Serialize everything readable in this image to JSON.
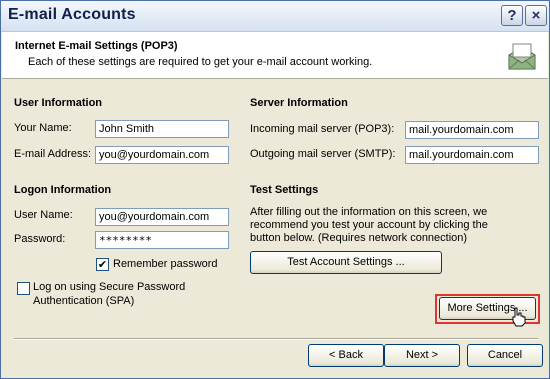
{
  "window": {
    "title": "E-mail Accounts",
    "help_glyph": "?",
    "close_glyph": "×"
  },
  "header": {
    "title": "Internet E-mail Settings (POP3)",
    "subtitle": "Each of these settings are required to get your e-mail account working.",
    "icon": "mail-envelope-icon"
  },
  "user_info": {
    "heading": "User Information",
    "name_label": "Your Name:",
    "name_value": "John Smith",
    "email_label": "E-mail Address:",
    "email_value": "you@yourdomain.com"
  },
  "logon_info": {
    "heading": "Logon Information",
    "user_label": "User Name:",
    "user_value": "you@yourdomain.com",
    "password_label": "Password:",
    "password_value": "********",
    "remember_label": "Remember password",
    "remember_checked": true,
    "spa_label_line1": "Log on using Secure Password",
    "spa_label_line2": "Authentication (SPA)",
    "spa_checked": false
  },
  "server_info": {
    "heading": "Server Information",
    "incoming_label": "Incoming mail server (POP3):",
    "incoming_value": "mail.yourdomain.com",
    "outgoing_label": "Outgoing mail server (SMTP):",
    "outgoing_value": "mail.yourdomain.com"
  },
  "test_settings": {
    "heading": "Test Settings",
    "description": "After filling out the information on this screen, we recommend you test your account by clicking the button below. (Requires network connection)",
    "test_button": "Test Account Settings ..."
  },
  "more_settings_button": "More Settings ...",
  "footer": {
    "back_button": "< Back",
    "next_button": "Next >",
    "cancel_button": "Cancel"
  },
  "colors": {
    "highlight_border": "#e0342e",
    "dialog_face": "#ece9d8",
    "field_border": "#7f9db9"
  }
}
